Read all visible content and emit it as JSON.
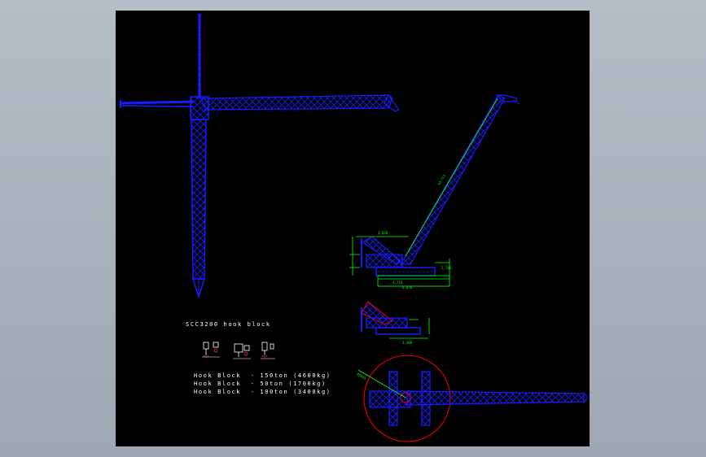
{
  "viewport": {
    "background": "#000000",
    "app_background": "#a9b1bc"
  },
  "colors": {
    "crane_lines": "#1a1aff",
    "dimension_lines": "#00ff00",
    "boom_outline": "#ff0000",
    "circle": "#ff0000",
    "text": "#ffffff"
  },
  "drawing": {
    "hook_block_title": "SCC3200 hook block",
    "hook_block_lines": [
      "Hook Block  - 150ton (4600kg)",
      "Hook Block  - 50ton (1700kg)",
      "Hook Block  - 100ton (3400kg)"
    ],
    "dim_boom_length": "43,311",
    "dim_top_width": "3,838",
    "dim_base_1": "4,778",
    "dim_base_2": "8,078",
    "dim_height_right": "2,780",
    "dim_transport_length": "3,488",
    "dim_radius": "R5945"
  }
}
